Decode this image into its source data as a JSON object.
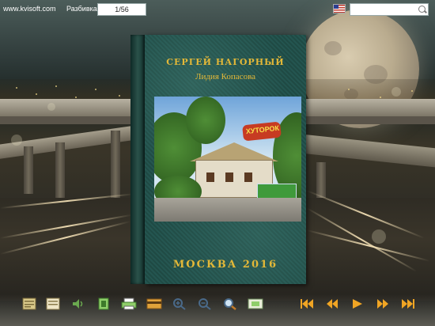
{
  "topbar": {
    "site": "www.kvisoft.com",
    "page_label": "Разбивка:",
    "page_value": "1/56",
    "language_flag": "us-flag-icon",
    "search_value": ""
  },
  "book": {
    "author_1": "СЕРГЕЙ НАГОРНЫЙ",
    "author_2": "Лидия Копасова",
    "sign_text": "ХУТОРОК",
    "city_year": "МОСКВА 2016"
  },
  "colors": {
    "cover": "#245550",
    "title_gold": "#e3b838",
    "nav_orange": "#f0a524"
  },
  "toolbar": {
    "tools": [
      {
        "name": "table-of-contents-icon"
      },
      {
        "name": "thumbnails-icon"
      },
      {
        "name": "sound-icon"
      },
      {
        "name": "share-icon"
      },
      {
        "name": "print-icon"
      },
      {
        "name": "download-icon"
      },
      {
        "name": "zoom-in-icon"
      },
      {
        "name": "zoom-out-icon"
      },
      {
        "name": "search-zoom-icon"
      },
      {
        "name": "fit-screen-icon"
      }
    ],
    "nav": [
      {
        "name": "first-page-icon"
      },
      {
        "name": "previous-page-icon"
      },
      {
        "name": "autoplay-icon"
      },
      {
        "name": "next-page-icon"
      },
      {
        "name": "last-page-icon"
      }
    ]
  }
}
